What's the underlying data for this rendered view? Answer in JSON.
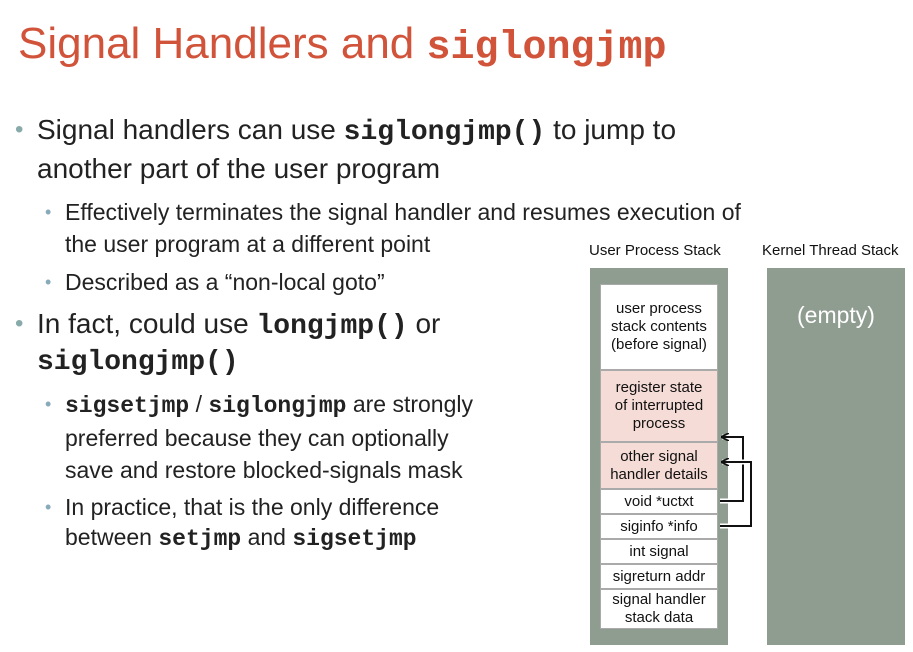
{
  "title": {
    "text": "Signal Handlers and ",
    "mono": "siglongjmp"
  },
  "bullets": {
    "b1": {
      "pre": "Signal handlers can use ",
      "code": "siglongjmp()",
      "post": " to jump to",
      "line2": "another part of the user program"
    },
    "b1a": {
      "line1": "Effectively terminates the signal handler and resumes execution of",
      "line2": "the user program at a different point"
    },
    "b1b": {
      "text": "Described as a “non-local goto”"
    },
    "b2": {
      "pre": "In fact, could use ",
      "code1": "longjmp()",
      "mid": " or",
      "code2": "siglongjmp()"
    },
    "b2a": {
      "code1": "sigsetjmp",
      "sep": " / ",
      "code2": "siglongjmp",
      "post": " are strongly",
      "line2": "preferred because they can optionally",
      "line3": "save and restore blocked-signals mask"
    },
    "b2b": {
      "line1": "In practice, that is the only difference",
      "pre": "between ",
      "code1": "setjmp",
      "mid": " and ",
      "code2": "sigsetjmp"
    }
  },
  "diagram": {
    "user_stack_label": "User Process Stack",
    "kernel_stack_label": "Kernel Thread Stack",
    "kernel_empty": "(empty)",
    "frames": [
      {
        "l1": "user process",
        "l2": "stack contents",
        "l3": "(before signal)"
      },
      {
        "l1": "register state",
        "l2": "of interrupted",
        "l3": "process"
      },
      {
        "l1": "other signal",
        "l2": "handler details"
      },
      {
        "l1": "void *uctxt"
      },
      {
        "l1": "siginfo *info"
      },
      {
        "l1": "int signal"
      },
      {
        "l1": "sigreturn addr"
      },
      {
        "l1": "signal handler",
        "l2": "stack data"
      }
    ],
    "colors": {
      "title": "#d0533a",
      "stack_bg": "#8f9c90",
      "pink_frame": "#f6dcd6"
    }
  }
}
